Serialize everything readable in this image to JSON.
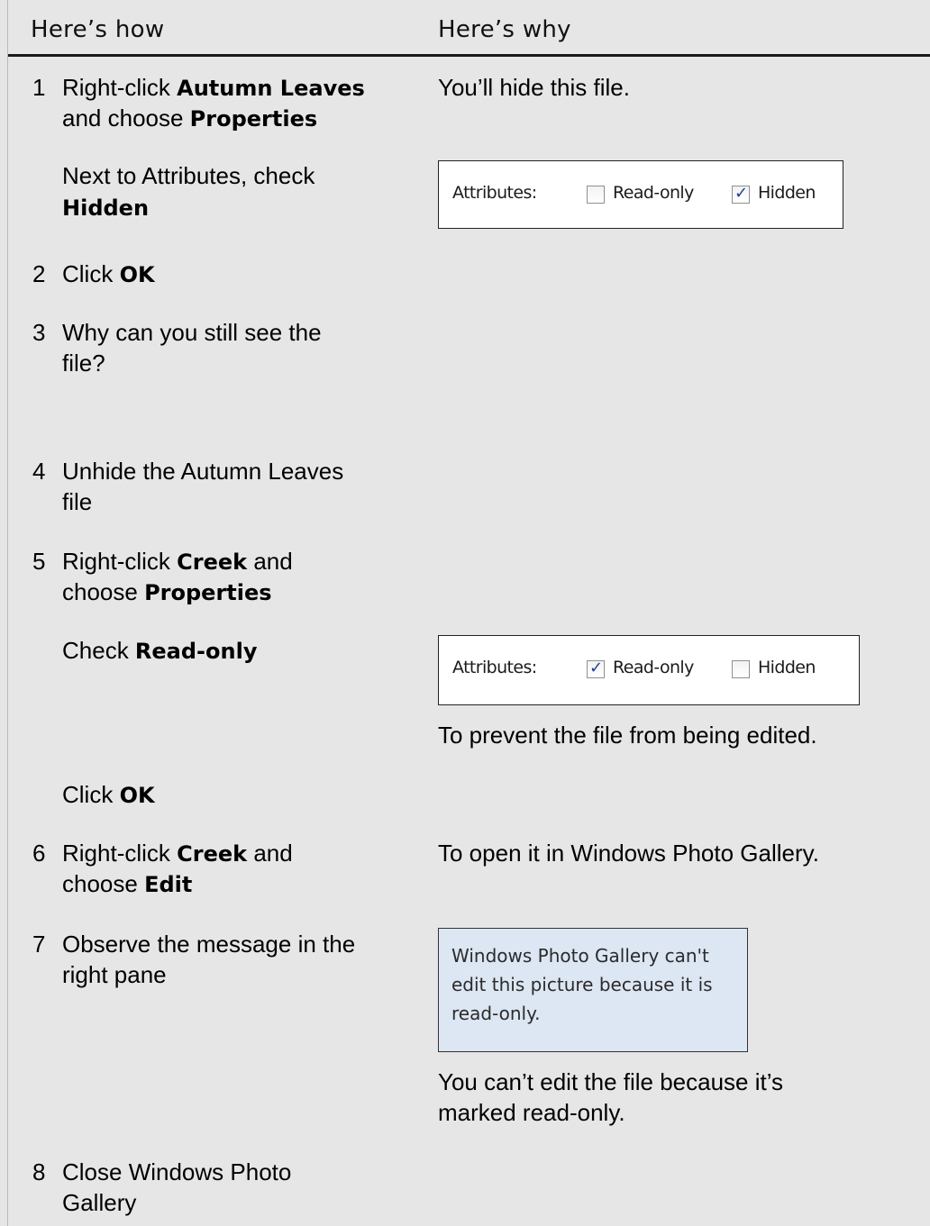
{
  "header": {
    "col_how": "Here’s how",
    "col_why": "Here’s why"
  },
  "steps": {
    "s1": {
      "num": "1",
      "pre": "Right-click ",
      "bold1": "Autumn Leaves",
      "line2_pre": "and choose ",
      "bold2": "Properties",
      "why": "You’ll hide this file."
    },
    "s1b": {
      "line1": "Next to Attributes, check",
      "bold": "Hidden"
    },
    "s2": {
      "num": "2",
      "pre": "Click ",
      "bold": "OK"
    },
    "s3": {
      "num": "3",
      "line1": "Why can you still see the",
      "line2": "file?"
    },
    "s4": {
      "num": "4",
      "line1": "Unhide the Autumn Leaves",
      "line2": "file"
    },
    "s5": {
      "num": "5",
      "pre": "Right-click ",
      "bold1": "Creek",
      "post": " and",
      "line2_pre": "choose ",
      "bold2": "Properties"
    },
    "s5b": {
      "pre": "Check ",
      "bold": "Read-only",
      "why": "To prevent the file from being edited."
    },
    "s5c": {
      "pre": "Click ",
      "bold": "OK"
    },
    "s6": {
      "num": "6",
      "pre": "Right-click ",
      "bold1": "Creek",
      "post": " and",
      "line2_pre": "choose ",
      "bold2": "Edit",
      "why": "To open it in Windows Photo Gallery."
    },
    "s7": {
      "num": "7",
      "line1": "Observe the message in the",
      "line2": "right pane",
      "why1": "You can’t edit the file because it’s",
      "why2": "marked read-only."
    },
    "s8": {
      "num": "8",
      "line1": "Close Windows Photo",
      "line2": "Gallery"
    }
  },
  "attr_box_1": {
    "label": "Attributes:",
    "readonly_label": "Read-only",
    "readonly_checked": false,
    "hidden_label": "Hidden",
    "hidden_checked": true
  },
  "attr_box_2": {
    "label": "Attributes:",
    "readonly_label": "Read-only",
    "readonly_checked": true,
    "hidden_label": "Hidden",
    "hidden_checked": false
  },
  "gallery_message": {
    "line1": "Windows Photo Gallery can't",
    "line2": "edit this picture because it is",
    "line3": "read-only."
  },
  "icons": {
    "checkmark": "✓"
  },
  "colors": {
    "background": "#e6e6e6",
    "message_bg": "#dde6f3",
    "check": "#1f3f95"
  }
}
